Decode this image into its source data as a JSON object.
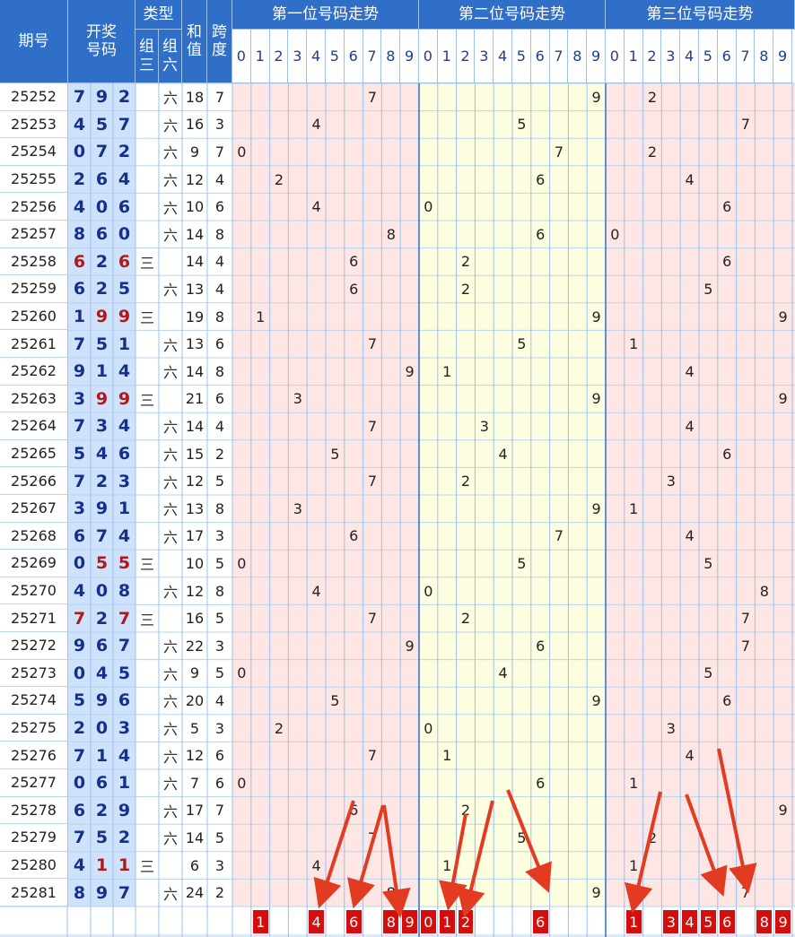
{
  "headers": {
    "issue": "期号",
    "draw": [
      "开奖",
      "号码"
    ],
    "type": "类型",
    "type_z3": [
      "组",
      "三"
    ],
    "type_z6": [
      "组",
      "六"
    ],
    "sum": [
      "和",
      "值"
    ],
    "span": [
      "跨",
      "度"
    ],
    "pos1": "第一位号码走势",
    "pos2": "第二位号码走势",
    "pos3": "第三位号码走势",
    "digits": [
      "0",
      "1",
      "2",
      "3",
      "4",
      "5",
      "6",
      "7",
      "8",
      "9"
    ]
  },
  "type_labels": {
    "z3": "三",
    "z6": "六"
  },
  "colors": {
    "header_bg": "#2f6fc7",
    "draw_bg": "#cfe2fb",
    "pos1_bg": "#fde6e4",
    "pos2_bg": "#fdfde0",
    "pos3_bg": "#fde6e4",
    "digit_blue": "#14308a",
    "digit_red": "#b3171b",
    "pick_red": "#d40d0d"
  },
  "chart_data": {
    "type": "table",
    "rows": [
      {
        "issue": "25252",
        "n": [
          7,
          9,
          2
        ],
        "type": "六",
        "sum": 18,
        "span": 7
      },
      {
        "issue": "25253",
        "n": [
          4,
          5,
          7
        ],
        "type": "六",
        "sum": 16,
        "span": 3
      },
      {
        "issue": "25254",
        "n": [
          0,
          7,
          2
        ],
        "type": "六",
        "sum": 9,
        "span": 7
      },
      {
        "issue": "25255",
        "n": [
          2,
          6,
          4
        ],
        "type": "六",
        "sum": 12,
        "span": 4
      },
      {
        "issue": "25256",
        "n": [
          4,
          0,
          6
        ],
        "type": "六",
        "sum": 10,
        "span": 6
      },
      {
        "issue": "25257",
        "n": [
          8,
          6,
          0
        ],
        "type": "六",
        "sum": 14,
        "span": 8
      },
      {
        "issue": "25258",
        "n": [
          6,
          2,
          6
        ],
        "type": "三",
        "sum": 14,
        "span": 4
      },
      {
        "issue": "25259",
        "n": [
          6,
          2,
          5
        ],
        "type": "六",
        "sum": 13,
        "span": 4
      },
      {
        "issue": "25260",
        "n": [
          1,
          9,
          9
        ],
        "type": "三",
        "sum": 19,
        "span": 8
      },
      {
        "issue": "25261",
        "n": [
          7,
          5,
          1
        ],
        "type": "六",
        "sum": 13,
        "span": 6
      },
      {
        "issue": "25262",
        "n": [
          9,
          1,
          4
        ],
        "type": "六",
        "sum": 14,
        "span": 8
      },
      {
        "issue": "25263",
        "n": [
          3,
          9,
          9
        ],
        "type": "三",
        "sum": 21,
        "span": 6
      },
      {
        "issue": "25264",
        "n": [
          7,
          3,
          4
        ],
        "type": "六",
        "sum": 14,
        "span": 4
      },
      {
        "issue": "25265",
        "n": [
          5,
          4,
          6
        ],
        "type": "六",
        "sum": 15,
        "span": 2
      },
      {
        "issue": "25266",
        "n": [
          7,
          2,
          3
        ],
        "type": "六",
        "sum": 12,
        "span": 5
      },
      {
        "issue": "25267",
        "n": [
          3,
          9,
          1
        ],
        "type": "六",
        "sum": 13,
        "span": 8
      },
      {
        "issue": "25268",
        "n": [
          6,
          7,
          4
        ],
        "type": "六",
        "sum": 17,
        "span": 3
      },
      {
        "issue": "25269",
        "n": [
          0,
          5,
          5
        ],
        "type": "三",
        "sum": 10,
        "span": 5
      },
      {
        "issue": "25270",
        "n": [
          4,
          0,
          8
        ],
        "type": "六",
        "sum": 12,
        "span": 8
      },
      {
        "issue": "25271",
        "n": [
          7,
          2,
          7
        ],
        "type": "三",
        "sum": 16,
        "span": 5
      },
      {
        "issue": "25272",
        "n": [
          9,
          6,
          7
        ],
        "type": "六",
        "sum": 22,
        "span": 3
      },
      {
        "issue": "25273",
        "n": [
          0,
          4,
          5
        ],
        "type": "六",
        "sum": 9,
        "span": 5
      },
      {
        "issue": "25274",
        "n": [
          5,
          9,
          6
        ],
        "type": "六",
        "sum": 20,
        "span": 4
      },
      {
        "issue": "25275",
        "n": [
          2,
          0,
          3
        ],
        "type": "六",
        "sum": 5,
        "span": 3
      },
      {
        "issue": "25276",
        "n": [
          7,
          1,
          4
        ],
        "type": "六",
        "sum": 12,
        "span": 6
      },
      {
        "issue": "25277",
        "n": [
          0,
          6,
          1
        ],
        "type": "六",
        "sum": 7,
        "span": 6
      },
      {
        "issue": "25278",
        "n": [
          6,
          2,
          9
        ],
        "type": "六",
        "sum": 17,
        "span": 7
      },
      {
        "issue": "25279",
        "n": [
          7,
          5,
          2
        ],
        "type": "六",
        "sum": 14,
        "span": 5
      },
      {
        "issue": "25280",
        "n": [
          4,
          1,
          1
        ],
        "type": "三",
        "sum": 6,
        "span": 3
      },
      {
        "issue": "25281",
        "n": [
          8,
          9,
          7
        ],
        "type": "六",
        "sum": 24,
        "span": 2
      }
    ],
    "picks": {
      "pos1": [
        "1",
        "4",
        "6",
        "8",
        "9"
      ],
      "pos2": [
        "0",
        "1",
        "2",
        "6"
      ],
      "pos3": [
        "1",
        "3",
        "4",
        "5",
        "6",
        "8",
        "9"
      ]
    }
  }
}
